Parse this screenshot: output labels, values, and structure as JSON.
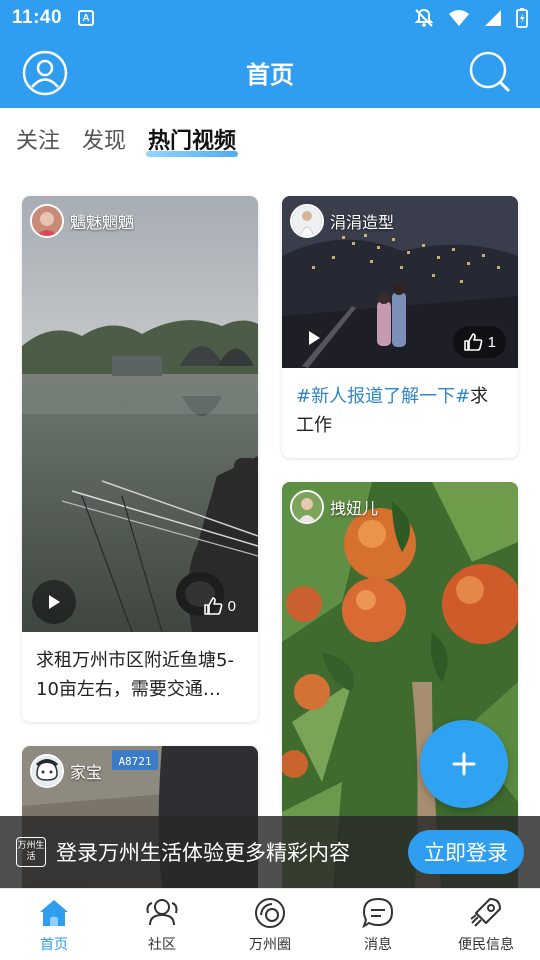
{
  "status_bar": {
    "time": "11:40",
    "badge": "A"
  },
  "app_bar": {
    "title": "首页"
  },
  "tabs": [
    {
      "label": "关注",
      "active": false
    },
    {
      "label": "发现",
      "active": false
    },
    {
      "label": "热门视频",
      "active": true
    }
  ],
  "feed": [
    {
      "author": "魑魅魍魉",
      "likes": "0",
      "caption": "求租万州市区附近鱼塘5-10亩左右，需要交通…",
      "type": "video"
    },
    {
      "author": "涓涓造型",
      "likes": "1",
      "caption_tag": "#新人报道了解一下#",
      "caption": "求工作",
      "type": "video"
    },
    {
      "author": "拽妞儿",
      "type": "video"
    },
    {
      "author": "家宝",
      "type": "video",
      "plate_text": "A8721"
    }
  ],
  "login_banner": {
    "logo_text": "万州生活",
    "text": "登录万州生活体验更多精彩内容",
    "button": "立即登录"
  },
  "bottom_nav": [
    {
      "label": "首页",
      "icon": "home-icon",
      "active": true
    },
    {
      "label": "社区",
      "icon": "community-icon",
      "active": false
    },
    {
      "label": "万州圈",
      "icon": "circle-icon",
      "active": false
    },
    {
      "label": "消息",
      "icon": "message-icon",
      "active": false
    },
    {
      "label": "便民信息",
      "icon": "rocket-icon",
      "active": false
    }
  ],
  "colors": {
    "brand": "#2f9df0",
    "tag": "#2f86c8",
    "banner_bg": "#282828"
  }
}
